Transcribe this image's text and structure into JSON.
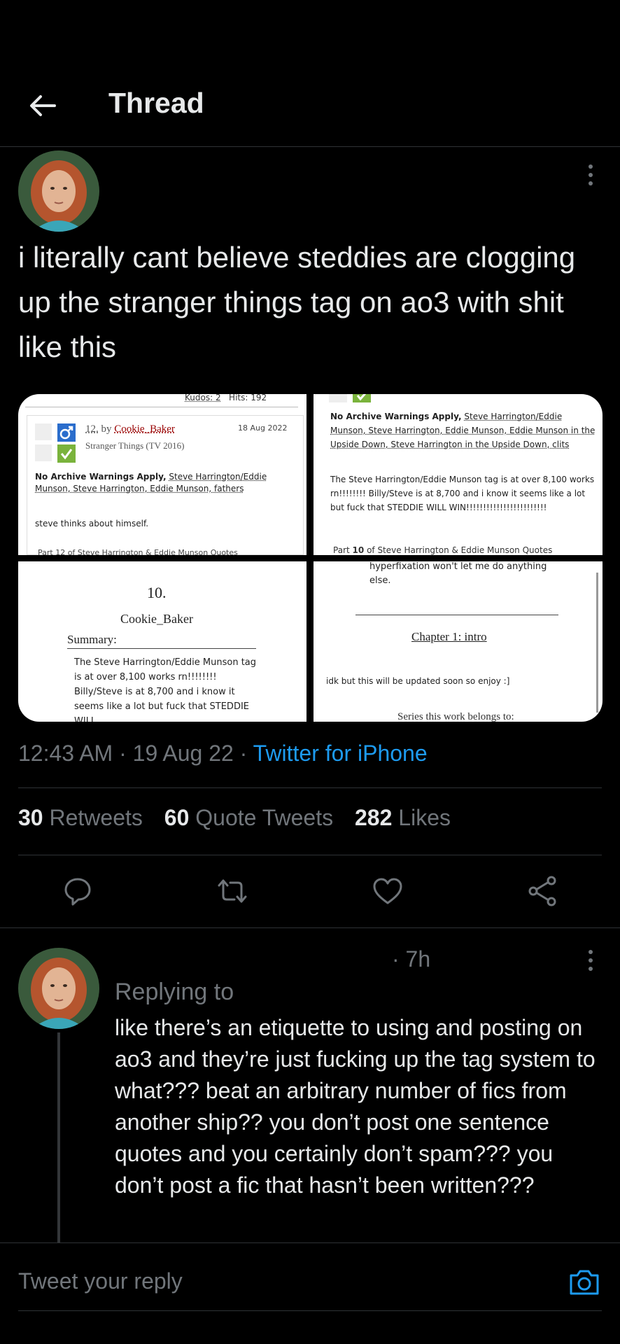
{
  "header": {
    "title": "Thread"
  },
  "tweet": {
    "text": "i literally cant believe steddies are clogging up the stranger things tag on ao3 with shit like this",
    "time": "12:43 AM",
    "date": "19 Aug 22",
    "source": "Twitter for iPhone",
    "retweets": "30",
    "retweets_label": "Retweets",
    "quotes": "60",
    "quotes_label": "Quote Tweets",
    "likes": "282",
    "likes_label": "Likes"
  },
  "media": {
    "t1": {
      "kudos": "Kudos: 2",
      "hits": "Hits: 192",
      "work_no": "12.",
      "by": "by",
      "author": "Cookie_Baker",
      "date": "18 Aug 2022",
      "fandom": "Stranger Things (TV 2016)",
      "warnings": "No Archive Warnings Apply,",
      "tags": "Steve Harrington/Eddie Munson, Steve Harrington, Eddie Munson, fathers",
      "summary": "steve thinks about himself.",
      "series": "Part 12 of Steve Harrington & Eddie Munson Quotes"
    },
    "t2": {
      "warnings": "No Archive Warnings Apply,",
      "tags": "Steve Harrington/Eddie Munson, Steve Harrington, Eddie Munson, Eddie Munson in the Upside Down, Steve Harrington in the Upside Down, clits",
      "summary": "The Steve Harrington/Eddie Munson tag is at over 8,100 works rn!!!!!!!! Billy/Steve is at 8,700 and i know it seems like a lot but fuck that STEDDIE WILL WIN!!!!!!!!!!!!!!!!!!!!!!!!",
      "series_prefix": "Part",
      "series_num": "10",
      "series_rest": "of Steve Harrington & Eddie Munson Quotes"
    },
    "t3": {
      "number": "10.",
      "author": "Cookie_Baker",
      "summary_label": "Summary:",
      "summary": "The Steve Harrington/Eddie Munson tag is at over 8,100 works rn!!!!!!!! Billy/Steve is at 8,700 and i know it seems like a lot but fuck that STEDDIE WILL"
    },
    "t4": {
      "top_text": "hyperfixation won't let me do anything else.",
      "chapter": "Chapter 1: intro",
      "note": "idk but this will be updated soon so enjoy :]",
      "series": "Series this work belongs to:"
    }
  },
  "reply": {
    "time": "· 7h",
    "replying_to": "Replying to",
    "text": "like there’s an etiquette to using and posting on ao3 and they’re just fucking up the tag system to what??? beat an arbitrary number of fics from another ship?? you don’t post one sentence quotes and you certainly don’t spam??? you don’t post a fic that hasn’t been written???"
  },
  "composer": {
    "placeholder": "Tweet your reply"
  },
  "colors": {
    "accent": "#1d9bf0",
    "muted": "#71767b",
    "text": "#e7e9ea",
    "bg": "#000000"
  },
  "icons": [
    "back-arrow-icon",
    "more-icon",
    "reply-icon",
    "retweet-icon",
    "like-icon",
    "share-icon",
    "camera-icon"
  ]
}
